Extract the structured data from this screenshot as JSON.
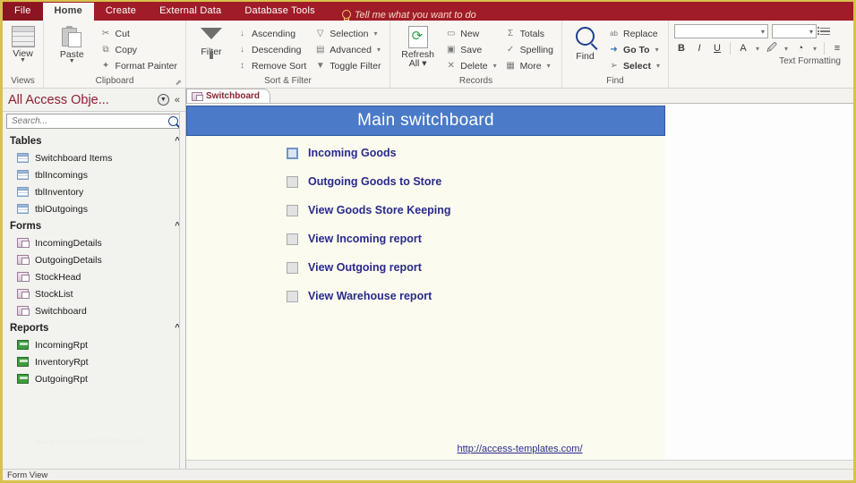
{
  "tabs": {
    "file": "File",
    "items": [
      "Home",
      "Create",
      "External Data",
      "Database Tools"
    ],
    "tellme": "Tell me what you want to do"
  },
  "ribbon": {
    "groups": [
      {
        "name": "Views",
        "label": "Views",
        "big": {
          "label": "View",
          "icon": "view-grid-icon"
        },
        "items": []
      },
      {
        "name": "Clipboard",
        "label": "Clipboard",
        "big": {
          "label": "Paste",
          "icon": "paste-icon"
        },
        "items": [
          {
            "label": "Cut",
            "icon": "scissors-icon"
          },
          {
            "label": "Copy",
            "icon": "copy-icon"
          },
          {
            "label": "Format Painter",
            "icon": "format-painter-icon"
          }
        ],
        "dialog_launcher": true
      },
      {
        "name": "Sort & Filter",
        "label": "Sort & Filter",
        "big": {
          "label": "Filter",
          "icon": "funnel-icon"
        },
        "items": [
          {
            "label": "Ascending",
            "icon": "sort-asc-icon"
          },
          {
            "label": "Descending",
            "icon": "sort-desc-icon"
          },
          {
            "label": "Remove Sort",
            "icon": "remove-sort-icon"
          }
        ],
        "items2": [
          {
            "label": "Selection",
            "icon": "selection-icon",
            "dropdown": true
          },
          {
            "label": "Advanced",
            "icon": "advanced-icon",
            "dropdown": true
          },
          {
            "label": "Toggle Filter",
            "icon": "toggle-filter-icon"
          }
        ]
      },
      {
        "name": "Records",
        "label": "Records",
        "big": {
          "label": "Refresh\nAll",
          "label1": "Refresh",
          "label2": "All",
          "icon": "refresh-icon",
          "dropdown": true
        },
        "items": [
          {
            "label": "New",
            "icon": "new-record-icon"
          },
          {
            "label": "Save",
            "icon": "save-icon"
          },
          {
            "label": "Delete",
            "icon": "delete-icon",
            "dropdown": true
          }
        ],
        "items2": [
          {
            "label": "Totals",
            "icon": "sigma-icon"
          },
          {
            "label": "Spelling",
            "icon": "spelling-icon"
          },
          {
            "label": "More",
            "icon": "more-icon",
            "dropdown": true
          }
        ]
      },
      {
        "name": "Find",
        "label": "Find",
        "big": {
          "label": "Find",
          "icon": "magnifier-icon"
        },
        "items": [
          {
            "label": "Replace",
            "icon": "replace-icon"
          },
          {
            "label": "Go To",
            "icon": "goto-arrow-icon",
            "dropdown": true
          },
          {
            "label": "Select",
            "icon": "select-pointer-icon",
            "dropdown": true
          }
        ]
      },
      {
        "name": "Text Formatting",
        "label": "Text Formatting",
        "font_combo_value": "",
        "size_combo_value": "",
        "buttons": [
          "B",
          "I",
          "U"
        ],
        "icons": [
          "font-color-icon",
          "highlight-icon",
          "fill-color-icon",
          "align-icon",
          "bullet-list-icon"
        ]
      }
    ]
  },
  "navpane": {
    "title": "All Access Obje...",
    "menu_icon": "dropdown-circle-icon",
    "collapse_icon": "double-chevron-left-icon",
    "search_placeholder": "Search...",
    "search_value": "",
    "search_icon": "search-icon",
    "groups": [
      {
        "name": "Tables",
        "collapse": "«",
        "items": [
          "Switchboard Items",
          "tblIncomings",
          "tblInventory",
          "tblOutgoings"
        ],
        "icon": "table-icon"
      },
      {
        "name": "Forms",
        "collapse": "«",
        "items": [
          "IncomingDetails",
          "OutgoingDetails",
          "StockHead",
          "StockList",
          "Switchboard"
        ],
        "icon": "form-icon"
      },
      {
        "name": "Reports",
        "collapse": "«",
        "items": [
          "IncomingRpt",
          "InventoryRpt",
          "OutgoingRpt"
        ],
        "icon": "report-icon"
      }
    ],
    "watermark": "www.access-templates.com"
  },
  "document": {
    "tab_label": "Switchboard",
    "tab_icon": "form-icon",
    "form": {
      "title": "Main switchboard",
      "header_color": "#4a7ac8",
      "body_color": "#fbfbf0",
      "items": [
        {
          "label": "Incoming Goods",
          "selected": true
        },
        {
          "label": "Outgoing Goods to Store",
          "selected": false
        },
        {
          "label": "View Goods Store Keeping",
          "selected": false
        },
        {
          "label": "View Incoming report",
          "selected": false
        },
        {
          "label": "View Outgoing report",
          "selected": false
        },
        {
          "label": "View Warehouse report",
          "selected": false
        }
      ],
      "footer_link": "http://access-templates.com/"
    }
  },
  "statusbar": {
    "text": "Form View"
  }
}
